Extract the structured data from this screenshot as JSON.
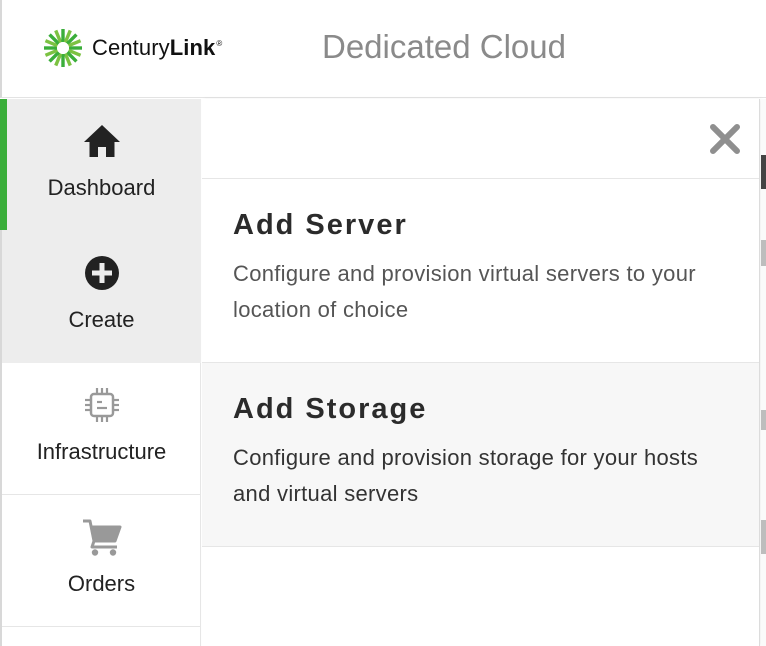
{
  "brand": {
    "name_regular": "Century",
    "name_bold": "Link",
    "trademark": "®",
    "logo_icon": "centurylink-logo-icon",
    "accent_color": "#3aae3a"
  },
  "header": {
    "title": "Dedicated Cloud"
  },
  "sidebar": {
    "items": [
      {
        "label": "Dashboard",
        "icon": "home-icon",
        "active": true
      },
      {
        "label": "Create",
        "icon": "plus-circle-icon",
        "active": false
      },
      {
        "label": "Infrastructure",
        "icon": "chip-icon",
        "active": false
      },
      {
        "label": "Orders",
        "icon": "cart-icon",
        "active": false
      }
    ]
  },
  "panel": {
    "close_icon": "close-icon",
    "options": [
      {
        "title": "Add Server",
        "description": "Configure and provision virtual servers to your location of choice"
      },
      {
        "title": "Add Storage",
        "description": "Configure and provision storage for your hosts and virtual servers"
      }
    ]
  }
}
